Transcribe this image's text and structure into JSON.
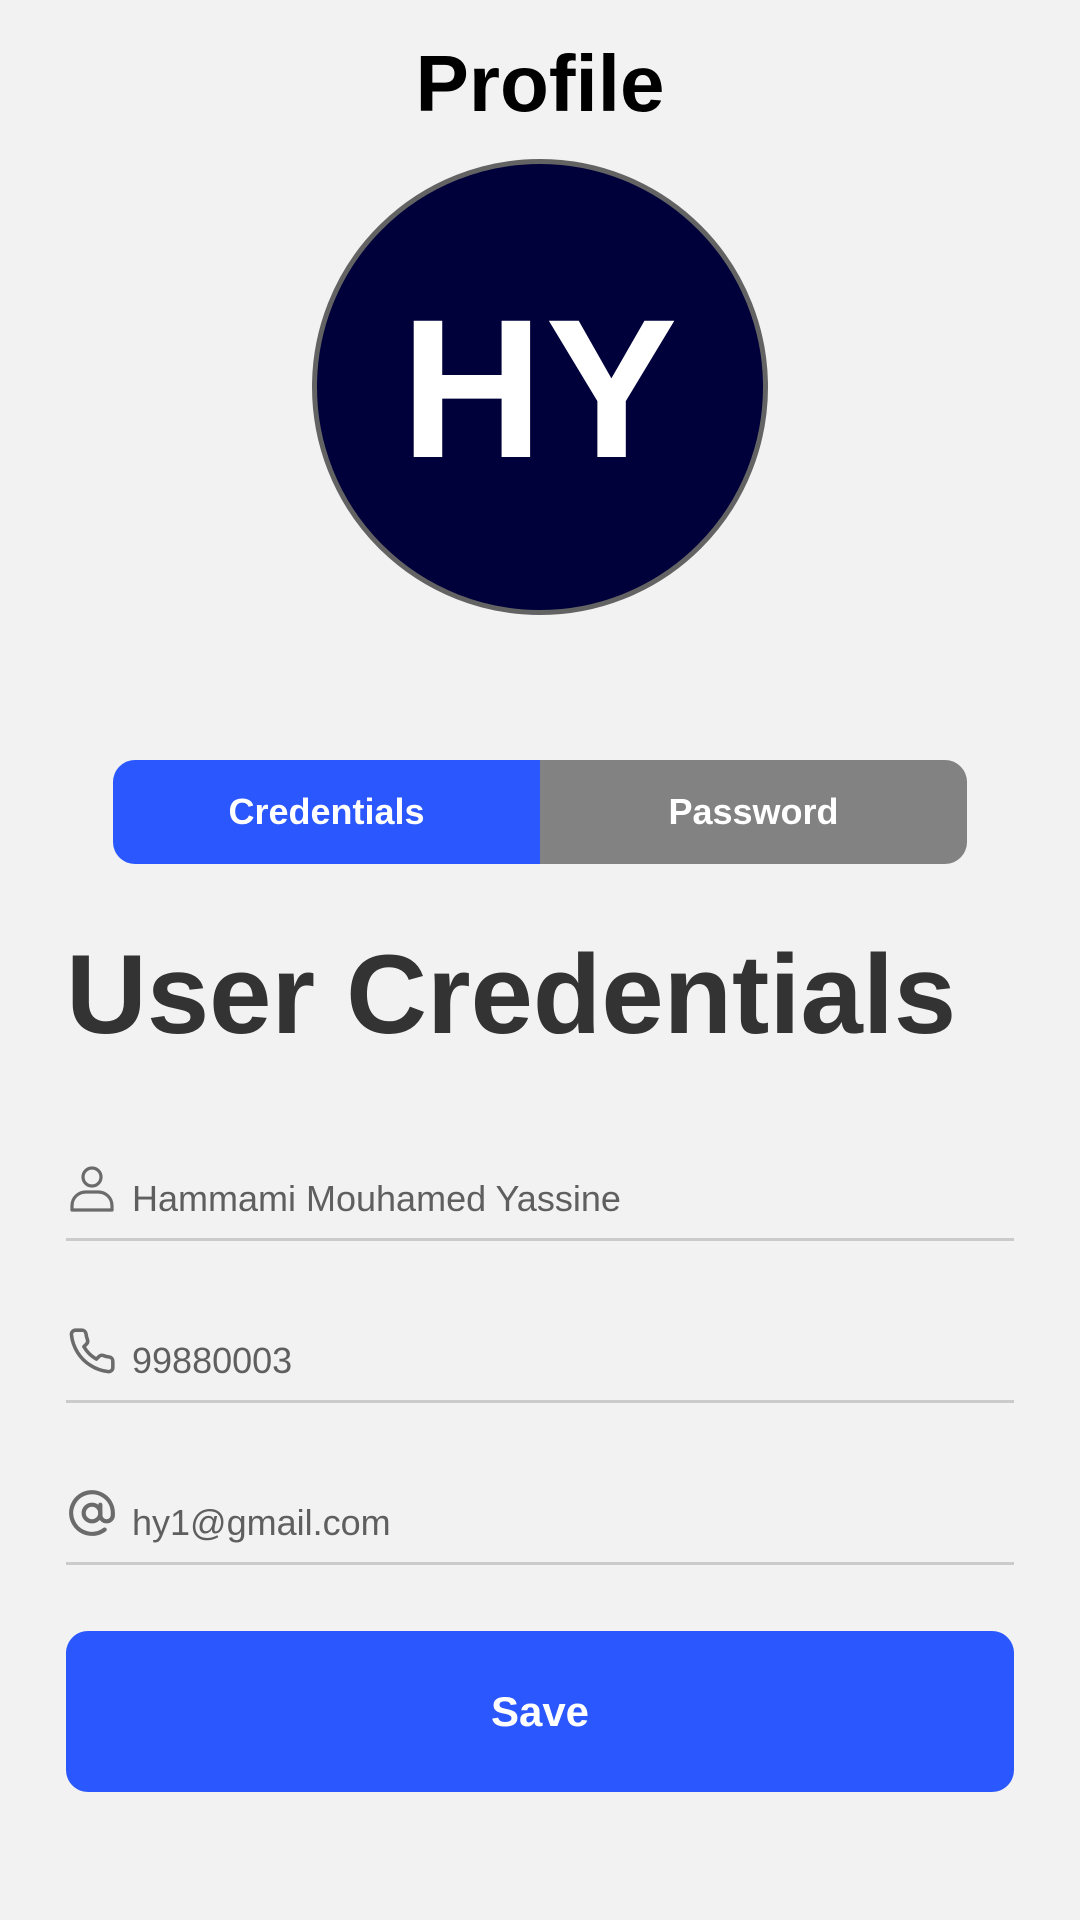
{
  "header": {
    "title": "Profile"
  },
  "avatar": {
    "initials": "HY",
    "background_color": "#00003a",
    "border_color": "#636363"
  },
  "tabs": [
    {
      "label": "Credentials",
      "active": true,
      "color": "#2b57fe"
    },
    {
      "label": "Password",
      "active": false,
      "color": "#828282"
    }
  ],
  "section": {
    "title": "User Credentials"
  },
  "fields": {
    "name": {
      "icon": "person-icon",
      "value": "Hammami Mouhamed Yassine"
    },
    "phone": {
      "icon": "phone-icon",
      "value": "99880003"
    },
    "email": {
      "icon": "at-sign-icon",
      "value": "hy1@gmail.com"
    }
  },
  "actions": {
    "save_label": "Save"
  },
  "colors": {
    "accent": "#2b57fe",
    "background": "#f2f2f3",
    "heading_text": "#333333",
    "field_text": "#5f5f5f"
  }
}
